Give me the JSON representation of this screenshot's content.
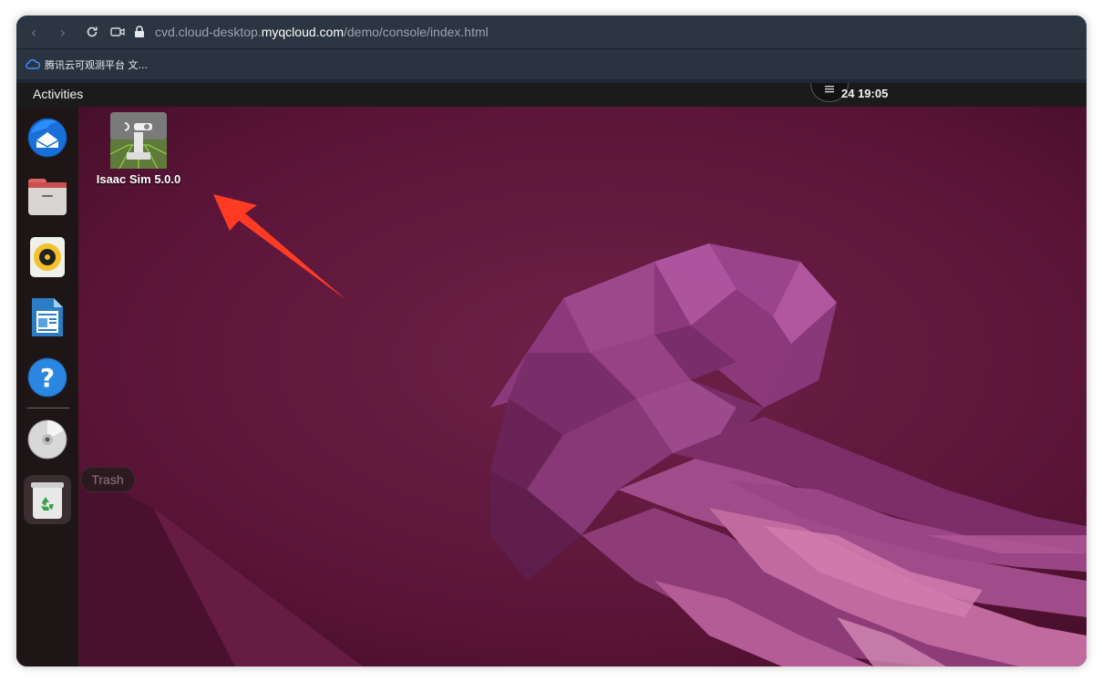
{
  "browser": {
    "url_prefix": "cvd.cloud-desktop.",
    "url_host": "myqcloud.com",
    "url_path": "/demo/console/index.html",
    "bookmarks": [
      {
        "label": "腾讯云可观测平台 文...",
        "icon": "cloud-icon"
      }
    ]
  },
  "topbar": {
    "activities": "Activities",
    "clock": "24  19:05",
    "overlay_icon": "menu-icon"
  },
  "dock": {
    "items": [
      {
        "name": "thunderbird",
        "icon": "thunderbird-icon"
      },
      {
        "name": "files",
        "icon": "files-icon"
      },
      {
        "name": "rhythmbox",
        "icon": "rhythmbox-icon"
      },
      {
        "name": "writer",
        "icon": "libreoffice-writer-icon"
      },
      {
        "name": "help",
        "icon": "help-icon"
      },
      {
        "name": "disc",
        "icon": "disc-icon"
      },
      {
        "name": "trash",
        "icon": "trash-icon"
      }
    ],
    "tooltip": "Trash"
  },
  "desktop": {
    "icons": [
      {
        "label": "Isaac Sim 5.0.0",
        "icon": "isaac-sim-icon"
      }
    ]
  },
  "colors": {
    "wallpaper_dark": "#3c0c22",
    "wallpaper_mid": "#6e1f45",
    "accent_arrow": "#ff3b24"
  }
}
